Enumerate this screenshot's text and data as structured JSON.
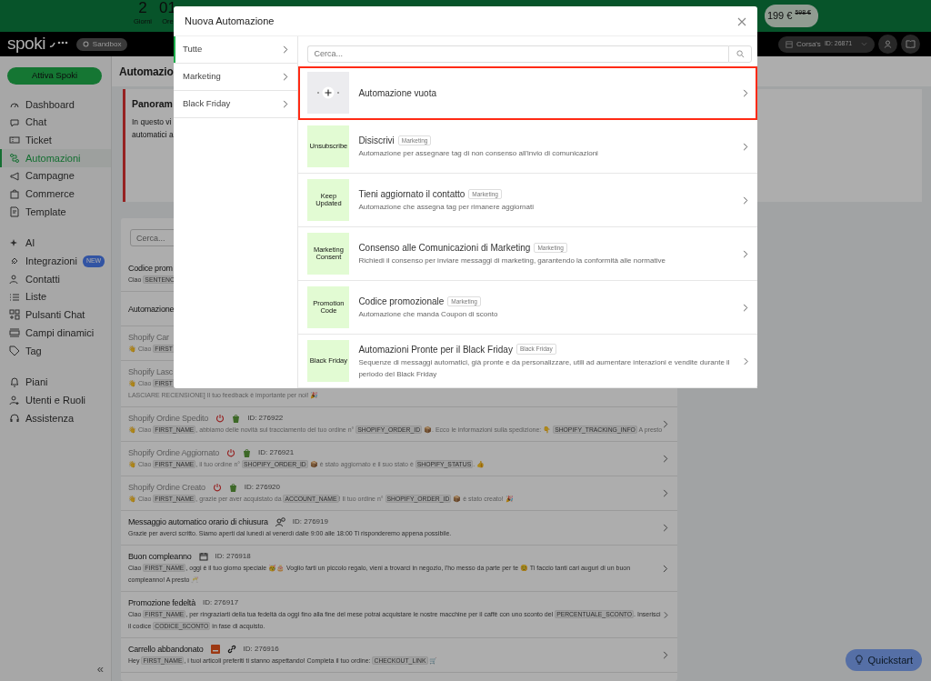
{
  "promo_banner": {
    "countdown": [
      {
        "value": "2",
        "unit": "Giorni"
      },
      {
        "value": "01",
        "unit": "Ore"
      }
    ],
    "price": "199 €",
    "old_price": "598 €"
  },
  "navbar": {
    "logo": "spoki",
    "environment": "Sandbox",
    "account": {
      "name": "Corsa's",
      "id": "ID: 26871"
    }
  },
  "sidebar": {
    "cta": "Attiva Spoki",
    "groups": [
      [
        {
          "label": "Dashboard",
          "selected": false
        },
        {
          "label": "Chat",
          "selected": false
        },
        {
          "label": "Ticket",
          "selected": false
        },
        {
          "label": "Automazioni",
          "selected": true
        },
        {
          "label": "Campagne",
          "selected": false
        },
        {
          "label": "Commerce",
          "selected": false
        },
        {
          "label": "Template",
          "selected": false
        }
      ],
      [
        {
          "label": "AI",
          "selected": false
        },
        {
          "label": "Integrazioni",
          "selected": false,
          "badge": "NEW"
        },
        {
          "label": "Contatti",
          "selected": false
        },
        {
          "label": "Liste",
          "selected": false
        },
        {
          "label": "Pulsanti Chat",
          "selected": false
        },
        {
          "label": "Campi dinamici",
          "selected": false
        },
        {
          "label": "Tag",
          "selected": false
        }
      ],
      [
        {
          "label": "Piani",
          "selected": false
        },
        {
          "label": "Utenti e Ruoli",
          "selected": false
        },
        {
          "label": "Assistenza",
          "selected": false
        }
      ]
    ],
    "collapse": "«"
  },
  "main": {
    "title": "Automazio",
    "panel": {
      "title": "Panoram",
      "lines": [
        "In questo vi",
        "automatici a"
      ]
    },
    "search": {
      "placeholder": "Cerca..."
    },
    "rows": [
      {
        "title": "Codice prom",
        "kind": "plain",
        "disabled": false,
        "message": [
          "Ciao ",
          "SENTENC"
        ]
      },
      {
        "title": "Automazione",
        "kind": "plain",
        "disabled": false
      },
      {
        "title": "Shopify Car",
        "kind": "plain",
        "disabled": true,
        "message": [
          "👋 Ciao ",
          "FIRST"
        ]
      },
      {
        "title": "Shopify Lasc",
        "kind": "plain",
        "disabled": true,
        "message": [
          "👋 Ciao ",
          "FIRST"
        ],
        "message_continued": "LASCIARE RECENSIONE] Il tuo feedback è importante per noi! 🎉"
      },
      {
        "title": "Shopify Ordine Spedito",
        "kind": "shopify",
        "disabled": true,
        "id": "ID: 276922",
        "message": [
          "👋 Ciao ",
          "FIRST_NAME",
          ", abbiamo delle novità sul tracciamento del tuo ordine n° ",
          "SHOPIFY_ORDER_ID",
          " 📦. Ecco le informazioni sulla spedizione: 👇 ",
          "SHOPIFY_TRACKING_INFO",
          " A presto"
        ]
      },
      {
        "title": "Shopify Ordine Aggiornato",
        "kind": "shopify",
        "disabled": true,
        "id": "ID: 276921",
        "message": [
          "👋 Ciao ",
          "FIRST_NAME",
          ", il tuo ordine n° ",
          "SHOPIFY_ORDER_ID",
          " 📦 è stato aggiornato e il suo stato è ",
          "SHOPIFY_STATUS",
          ". 👍"
        ]
      },
      {
        "title": "Shopify Ordine Creato",
        "kind": "shopify",
        "disabled": true,
        "id": "ID: 276920",
        "message": [
          "👋 Ciao ",
          "FIRST_NAME",
          ", grazie per aver acquistato da ",
          "ACCOUNT_NAME",
          "! Il tuo ordine n° ",
          "SHOPIFY_ORDER_ID",
          " 📦 è stato creato! 🎉"
        ]
      },
      {
        "title": "Messaggio automatico orario di chiusura",
        "kind": "away",
        "disabled": false,
        "id": "ID: 276919",
        "message": [
          "Grazie per averci scritto. Siamo aperti dal lunedì al venerdì dalle 9:00 alle 18:00 Ti risponderemo appena possibile."
        ]
      },
      {
        "title": "Buon compleanno",
        "kind": "birthday",
        "disabled": false,
        "id": "ID: 276918",
        "message": [
          "Ciao ",
          "FIRST_NAME",
          ", oggi è il tuo giorno speciale 🥳🎂 Voglio farti un piccolo regalo, vieni a trovarci in negozio, l'ho messo da parte per te 😊 Ti faccio tanti cari auguri di un buon compleanno! A presto 🥂"
        ]
      },
      {
        "title": "Promozione fedeltà",
        "kind": "plain",
        "disabled": false,
        "id": "ID: 276917",
        "message": [
          "Ciao ",
          "FIRST_NAME",
          ", per ringraziarti della tua fedeltà da oggi fino alla fine del mese potrai acquistare le nostre macchine per il caffè con uno sconto del ",
          "PERCENTUALE_SCONTO",
          ". Inserisci il codice ",
          "CODICE_SCONTO",
          " in fase di acquisto."
        ]
      },
      {
        "title": "Carrello abbandonato",
        "kind": "cart",
        "disabled": false,
        "id": "ID: 276916",
        "message": [
          "Hey ",
          "FIRST_NAME",
          ", i tuoi articoli preferiti ti stanno aspettando! Completa il tuo ordine: ",
          "CHECKOUT_LINK",
          " 🛒"
        ]
      }
    ]
  },
  "quickstart": "Quickstart",
  "modal": {
    "title": "Nuova Automazione",
    "categories": [
      {
        "label": "Tutte",
        "selected": true
      },
      {
        "label": "Marketing",
        "selected": false
      },
      {
        "label": "Black Friday",
        "selected": false
      }
    ],
    "search": {
      "placeholder": "Cerca..."
    },
    "templates": [
      {
        "kind": "blank",
        "title": "Automazione vuota",
        "highlighted": true
      },
      {
        "kind": "template",
        "thumb": "Unsubscribe",
        "title": "Disiscrivi",
        "tag": "Marketing",
        "description": "Automazione per assegnare tag di non consenso all'invio di comunicazioni",
        "highlighted": false
      },
      {
        "kind": "template",
        "thumb": "Keep Updated",
        "title": "Tieni aggiornato il contatto",
        "tag": "Marketing",
        "description": "Automazione che assegna tag per rimanere aggiornati",
        "highlighted": false
      },
      {
        "kind": "template",
        "thumb": "Marketing Consent",
        "title": "Consenso alle Comunicazioni di Marketing",
        "tag": "Marketing",
        "description": "Richiedi il consenso per inviare messaggi di marketing, garantendo la conformità alle normative",
        "highlighted": false
      },
      {
        "kind": "template",
        "thumb": "Promotion Code",
        "title": "Codice promozionale",
        "tag": "Marketing",
        "description": "Automazione che manda Coupon di sconto",
        "highlighted": false
      },
      {
        "kind": "template",
        "thumb": "Black Friday",
        "title": "Automazioni Pronte per il Black Friday",
        "tag": "Black Friday",
        "description": "Sequenze di messaggi automatici, già pronte e da personalizzare, utili ad aumentare interazioni e vendite durante il periodo del Black Friday",
        "highlighted": false
      }
    ]
  }
}
